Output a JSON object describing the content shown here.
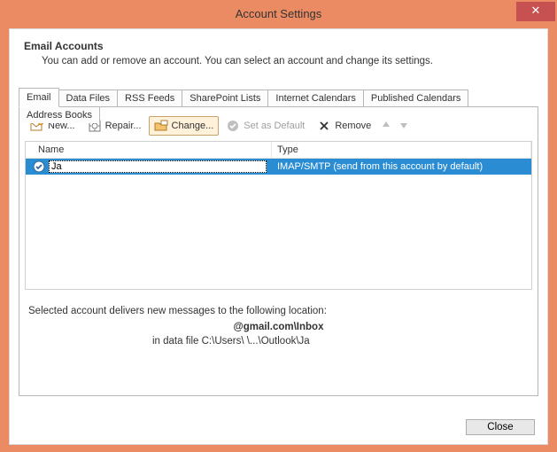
{
  "window": {
    "title": "Account Settings",
    "close": "✕"
  },
  "header": {
    "title": "Email Accounts",
    "description": "You can add or remove an account. You can select an account and change its settings."
  },
  "tabs": [
    {
      "label": "Email"
    },
    {
      "label": "Data Files"
    },
    {
      "label": "RSS Feeds"
    },
    {
      "label": "SharePoint Lists"
    },
    {
      "label": "Internet Calendars"
    },
    {
      "label": "Published Calendars"
    },
    {
      "label": "Address Books"
    }
  ],
  "toolbar": {
    "new": "New...",
    "repair": "Repair...",
    "change": "Change...",
    "set_default": "Set as Default",
    "remove": "Remove"
  },
  "list": {
    "headers": {
      "name": "Name",
      "type": "Type"
    },
    "rows": [
      {
        "name": "Ja",
        "type": "IMAP/SMTP (send from this account by default)"
      }
    ]
  },
  "footer": {
    "line1": "Selected account delivers new messages to the following location:",
    "line2": "@gmail.com\\Inbox",
    "line3": "in data file C:\\Users\\    \\...\\Outlook\\Ja"
  },
  "buttons": {
    "close": "Close"
  }
}
